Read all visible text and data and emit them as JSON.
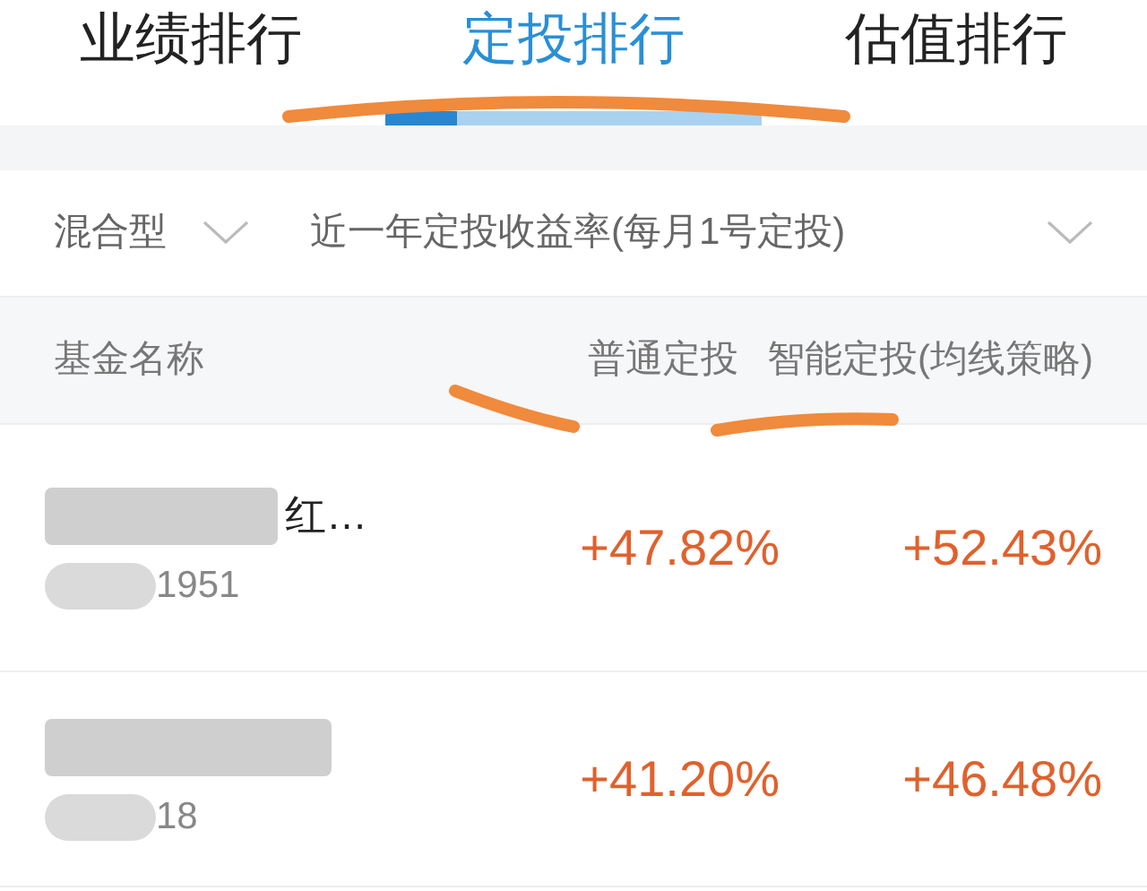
{
  "tabs": [
    {
      "label": "业绩排行",
      "selected": false
    },
    {
      "label": "定投排行",
      "selected": true
    },
    {
      "label": "估值排行",
      "selected": false
    }
  ],
  "filters": [
    {
      "label": "混合型"
    },
    {
      "label": "近一年定投收益率(每月1号定投)"
    }
  ],
  "columns": [
    "基金名称",
    "普通定投",
    "智能定投(均线策略)"
  ],
  "rows": [
    {
      "name": "红…",
      "code": "1951",
      "regular": "+47.82%",
      "smart": "+52.43%"
    },
    {
      "name": "",
      "code": "18",
      "regular": "+41.20%",
      "smart": "+46.48%"
    }
  ]
}
